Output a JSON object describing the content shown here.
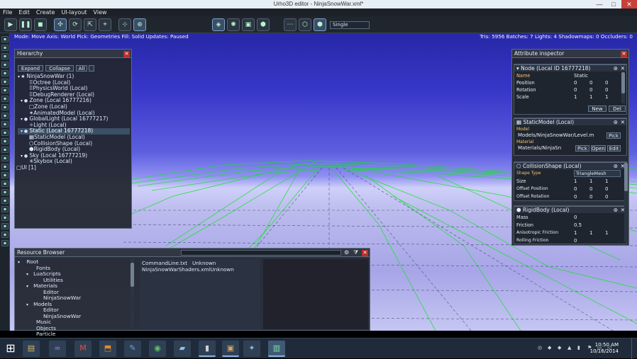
{
  "window": {
    "title": "Urho3D editor - NinjaSnowWar.xml*",
    "minimize": "—",
    "maximize": "□",
    "close": "✕"
  },
  "menu": {
    "items": [
      "File",
      "Edit",
      "Create",
      "UI-layout",
      "View"
    ]
  },
  "toolbar": {
    "buttons": [
      {
        "icon": "play-icon",
        "glyph": "▶"
      },
      {
        "icon": "pause-icon",
        "glyph": "❚❚"
      },
      {
        "icon": "revert-icon",
        "glyph": "◼"
      },
      {
        "icon": "move-icon",
        "glyph": "✣"
      },
      {
        "icon": "rotate-icon",
        "glyph": "⟳"
      },
      {
        "icon": "scale-icon",
        "glyph": "⇱"
      },
      {
        "icon": "select-icon",
        "glyph": "⌖"
      },
      {
        "icon": "local-axes-icon",
        "glyph": "⊹"
      },
      {
        "icon": "world-axes-icon",
        "glyph": "⊕"
      },
      {
        "icon": "pick-geometry-icon",
        "glyph": "◈"
      },
      {
        "icon": "pick-light-icon",
        "glyph": "✺"
      },
      {
        "icon": "pick-zone-icon",
        "glyph": "▣"
      },
      {
        "icon": "pick-rigidbody-icon",
        "glyph": "⬢"
      },
      {
        "icon": "fill-points-icon",
        "glyph": "⋯"
      },
      {
        "icon": "fill-wireframe-icon",
        "glyph": "⬡"
      },
      {
        "icon": "fill-solid-icon",
        "glyph": "⬢"
      }
    ],
    "view_select": "Single"
  },
  "infobar": {
    "left": "Mode: Move   Axis: World   Pick: Geometries   Fill: Solid   Updates: Paused",
    "right": "Tris: 5956   Batches: 7   Lights: 4   Shadowmaps: 0   Occluders: 0"
  },
  "hierarchy": {
    "title": "Hierarchy",
    "close": "✕",
    "buttons": {
      "expand": "Expand",
      "collapse": "Collapse",
      "all": "All"
    },
    "rows": [
      {
        "text": "NinjaSnowWar (1)",
        "indent": 0,
        "chev": "▾",
        "kind": "node",
        "selected": false
      },
      {
        "text": "Octree (Local)",
        "indent": 1,
        "chev": "",
        "kind": "comp",
        "selected": false
      },
      {
        "text": "PhysicsWorld (Local)",
        "indent": 1,
        "chev": "",
        "kind": "comp",
        "selected": false
      },
      {
        "text": "DebugRenderer (Local)",
        "indent": 1,
        "chev": "",
        "kind": "comp",
        "selected": false
      },
      {
        "text": "Zone (Local 16777216)",
        "indent": 0,
        "chev": "▾",
        "kind": "node",
        "selected": false
      },
      {
        "text": "Zone (Local)",
        "indent": 1,
        "chev": "",
        "kind": "comp",
        "selected": false
      },
      {
        "text": "AnimatedModel (Local)",
        "indent": 1,
        "chev": "",
        "kind": "comp",
        "selected": false
      },
      {
        "text": "GlobalLight (Local 16777217)",
        "indent": 0,
        "chev": "▾",
        "kind": "node",
        "selected": false
      },
      {
        "text": "Light (Local)",
        "indent": 1,
        "chev": "",
        "kind": "comp",
        "selected": false
      },
      {
        "text": "Static (Local 16777218)",
        "indent": 0,
        "chev": "▾",
        "kind": "node",
        "selected": true
      },
      {
        "text": "StaticModel (Local)",
        "indent": 1,
        "chev": "",
        "kind": "comp",
        "selected": false
      },
      {
        "text": "CollisionShape (Local)",
        "indent": 1,
        "chev": "",
        "kind": "comp",
        "selected": false
      },
      {
        "text": "RigidBody (Local)",
        "indent": 1,
        "chev": "",
        "kind": "comp",
        "selected": false
      },
      {
        "text": "Sky (Local 16777219)",
        "indent": 0,
        "chev": "▾",
        "kind": "node",
        "selected": false
      },
      {
        "text": "Skybox (Local)",
        "indent": 1,
        "chev": "",
        "kind": "comp",
        "selected": false
      },
      {
        "text": "UI [1]",
        "indent": -1,
        "chev": "",
        "kind": "ui",
        "selected": false
      }
    ]
  },
  "inspector": {
    "title": "Attribute inspector",
    "close": "✕",
    "node": {
      "title": "Node (Local ID 16777218)",
      "rows": [
        {
          "label": "Name",
          "values": [
            "Static"
          ]
        },
        {
          "label": "Position",
          "values": [
            "0",
            "0",
            "0"
          ]
        },
        {
          "label": "Rotation",
          "values": [
            "0",
            "0",
            "0"
          ]
        },
        {
          "label": "Scale",
          "values": [
            "1",
            "1",
            "1"
          ]
        }
      ],
      "new": "New",
      "del": "Del"
    },
    "staticmodel": {
      "title": "StaticModel (Local)",
      "model_label": "Model",
      "model_value": "Models/NinjaSnowWar/Level.m",
      "material_label": "Material",
      "material_value": "Materials/NinjaSn",
      "pick": "Pick",
      "open": "Open",
      "edit": "Edit"
    },
    "collision": {
      "title": "CollisionShape (Local)",
      "rows": [
        {
          "label": "Shape Type",
          "values": [
            "TriangleMesh"
          ]
        },
        {
          "label": "Size",
          "values": [
            "1",
            "1",
            "1"
          ]
        },
        {
          "label": "Offset Position",
          "values": [
            "0",
            "0",
            "0"
          ]
        },
        {
          "label": "Offset Rotation",
          "values": [
            "0",
            "0",
            "0"
          ]
        }
      ]
    },
    "rigidbody": {
      "title": "RigidBody (Local)",
      "rows": [
        {
          "label": "Mass",
          "values": [
            "0"
          ]
        },
        {
          "label": "Friction",
          "values": [
            "0.5"
          ]
        },
        {
          "label": "Anisotropic Friction",
          "values": [
            "1",
            "1",
            "1"
          ]
        },
        {
          "label": "Rolling Friction",
          "values": [
            "0"
          ]
        }
      ]
    }
  },
  "resources": {
    "title": "Resource Browser",
    "close": "✕",
    "items": [
      {
        "text": "Root",
        "indent": 0,
        "chev": "▾"
      },
      {
        "text": "Fonts",
        "indent": 1,
        "chev": ""
      },
      {
        "text": "LuaScripts",
        "indent": 1,
        "chev": "▾"
      },
      {
        "text": "Utilities",
        "indent": 2,
        "chev": ""
      },
      {
        "text": "Materials",
        "indent": 1,
        "chev": "▾"
      },
      {
        "text": "Editor",
        "indent": 2,
        "chev": ""
      },
      {
        "text": "NinjaSnowWar",
        "indent": 2,
        "chev": ""
      },
      {
        "text": "Models",
        "indent": 1,
        "chev": "▾"
      },
      {
        "text": "Editor",
        "indent": 2,
        "chev": ""
      },
      {
        "text": "NinjaSnowWar",
        "indent": 2,
        "chev": ""
      },
      {
        "text": "Music",
        "indent": 1,
        "chev": ""
      },
      {
        "text": "Objects",
        "indent": 1,
        "chev": ""
      },
      {
        "text": "Particle",
        "indent": 1,
        "chev": ""
      }
    ],
    "files": [
      {
        "name": "CommandLine.txt",
        "type": "Unknown"
      },
      {
        "name": "NinjaSnowWarShaders.xml",
        "type": "Unknown"
      }
    ]
  },
  "taskbar": {
    "start": "⊞",
    "apps": [
      {
        "icon": "file-explorer-icon",
        "glyph": "▤",
        "color": "#d9b45a"
      },
      {
        "icon": "visual-studio-icon",
        "glyph": "∞",
        "color": "#7d4ac4"
      },
      {
        "icon": "gmail-icon",
        "glyph": "M",
        "color": "#d9382f"
      },
      {
        "icon": "pdf-icon",
        "glyph": "⬒",
        "color": "#e48a2a"
      },
      {
        "icon": "paint-icon",
        "glyph": "✎",
        "color": "#4d7fc4"
      },
      {
        "icon": "chrome-icon",
        "glyph": "◉",
        "color": "#5aa85a"
      },
      {
        "icon": "notes-icon",
        "glyph": "▰",
        "color": "#6aa0c4"
      },
      {
        "icon": "terminal-icon",
        "glyph": "▮",
        "color": "#333333"
      },
      {
        "icon": "media-icon",
        "glyph": "▣",
        "color": "#8a6a3a"
      },
      {
        "icon": "tools-icon",
        "glyph": "✦",
        "color": "#4a6aa4"
      },
      {
        "icon": "urho3d-editor-icon",
        "glyph": "▥",
        "color": "#4f8f6f"
      }
    ],
    "time": "10:50 AM",
    "date": "10/16/2014"
  }
}
